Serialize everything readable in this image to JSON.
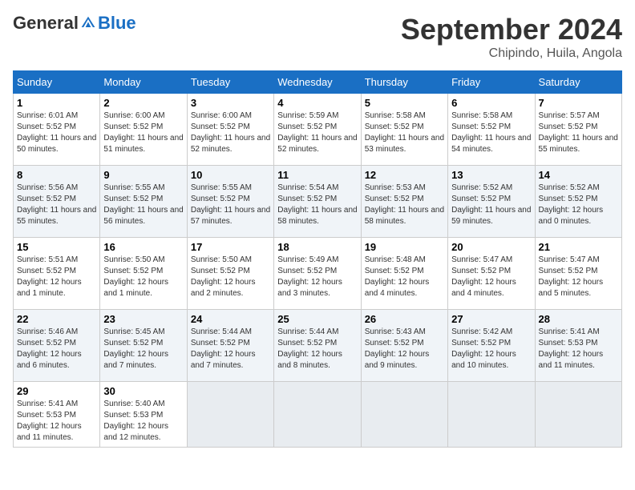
{
  "header": {
    "logo_general": "General",
    "logo_blue": "Blue",
    "month": "September 2024",
    "location": "Chipindo, Huila, Angola"
  },
  "days_of_week": [
    "Sunday",
    "Monday",
    "Tuesday",
    "Wednesday",
    "Thursday",
    "Friday",
    "Saturday"
  ],
  "weeks": [
    [
      {
        "day": 1,
        "sunrise": "6:01 AM",
        "sunset": "5:52 PM",
        "daylight": "11 hours and 50 minutes"
      },
      {
        "day": 2,
        "sunrise": "6:00 AM",
        "sunset": "5:52 PM",
        "daylight": "11 hours and 51 minutes"
      },
      {
        "day": 3,
        "sunrise": "6:00 AM",
        "sunset": "5:52 PM",
        "daylight": "11 hours and 52 minutes"
      },
      {
        "day": 4,
        "sunrise": "5:59 AM",
        "sunset": "5:52 PM",
        "daylight": "11 hours and 52 minutes"
      },
      {
        "day": 5,
        "sunrise": "5:58 AM",
        "sunset": "5:52 PM",
        "daylight": "11 hours and 53 minutes"
      },
      {
        "day": 6,
        "sunrise": "5:58 AM",
        "sunset": "5:52 PM",
        "daylight": "11 hours and 54 minutes"
      },
      {
        "day": 7,
        "sunrise": "5:57 AM",
        "sunset": "5:52 PM",
        "daylight": "11 hours and 55 minutes"
      }
    ],
    [
      {
        "day": 8,
        "sunrise": "5:56 AM",
        "sunset": "5:52 PM",
        "daylight": "11 hours and 55 minutes"
      },
      {
        "day": 9,
        "sunrise": "5:55 AM",
        "sunset": "5:52 PM",
        "daylight": "11 hours and 56 minutes"
      },
      {
        "day": 10,
        "sunrise": "5:55 AM",
        "sunset": "5:52 PM",
        "daylight": "11 hours and 57 minutes"
      },
      {
        "day": 11,
        "sunrise": "5:54 AM",
        "sunset": "5:52 PM",
        "daylight": "11 hours and 58 minutes"
      },
      {
        "day": 12,
        "sunrise": "5:53 AM",
        "sunset": "5:52 PM",
        "daylight": "11 hours and 58 minutes"
      },
      {
        "day": 13,
        "sunrise": "5:52 AM",
        "sunset": "5:52 PM",
        "daylight": "11 hours and 59 minutes"
      },
      {
        "day": 14,
        "sunrise": "5:52 AM",
        "sunset": "5:52 PM",
        "daylight": "12 hours and 0 minutes"
      }
    ],
    [
      {
        "day": 15,
        "sunrise": "5:51 AM",
        "sunset": "5:52 PM",
        "daylight": "12 hours and 1 minute"
      },
      {
        "day": 16,
        "sunrise": "5:50 AM",
        "sunset": "5:52 PM",
        "daylight": "12 hours and 1 minute"
      },
      {
        "day": 17,
        "sunrise": "5:50 AM",
        "sunset": "5:52 PM",
        "daylight": "12 hours and 2 minutes"
      },
      {
        "day": 18,
        "sunrise": "5:49 AM",
        "sunset": "5:52 PM",
        "daylight": "12 hours and 3 minutes"
      },
      {
        "day": 19,
        "sunrise": "5:48 AM",
        "sunset": "5:52 PM",
        "daylight": "12 hours and 4 minutes"
      },
      {
        "day": 20,
        "sunrise": "5:47 AM",
        "sunset": "5:52 PM",
        "daylight": "12 hours and 4 minutes"
      },
      {
        "day": 21,
        "sunrise": "5:47 AM",
        "sunset": "5:52 PM",
        "daylight": "12 hours and 5 minutes"
      }
    ],
    [
      {
        "day": 22,
        "sunrise": "5:46 AM",
        "sunset": "5:52 PM",
        "daylight": "12 hours and 6 minutes"
      },
      {
        "day": 23,
        "sunrise": "5:45 AM",
        "sunset": "5:52 PM",
        "daylight": "12 hours and 7 minutes"
      },
      {
        "day": 24,
        "sunrise": "5:44 AM",
        "sunset": "5:52 PM",
        "daylight": "12 hours and 7 minutes"
      },
      {
        "day": 25,
        "sunrise": "5:44 AM",
        "sunset": "5:52 PM",
        "daylight": "12 hours and 8 minutes"
      },
      {
        "day": 26,
        "sunrise": "5:43 AM",
        "sunset": "5:52 PM",
        "daylight": "12 hours and 9 minutes"
      },
      {
        "day": 27,
        "sunrise": "5:42 AM",
        "sunset": "5:52 PM",
        "daylight": "12 hours and 10 minutes"
      },
      {
        "day": 28,
        "sunrise": "5:41 AM",
        "sunset": "5:53 PM",
        "daylight": "12 hours and 11 minutes"
      }
    ],
    [
      {
        "day": 29,
        "sunrise": "5:41 AM",
        "sunset": "5:53 PM",
        "daylight": "12 hours and 11 minutes"
      },
      {
        "day": 30,
        "sunrise": "5:40 AM",
        "sunset": "5:53 PM",
        "daylight": "12 hours and 12 minutes"
      },
      null,
      null,
      null,
      null,
      null
    ]
  ]
}
